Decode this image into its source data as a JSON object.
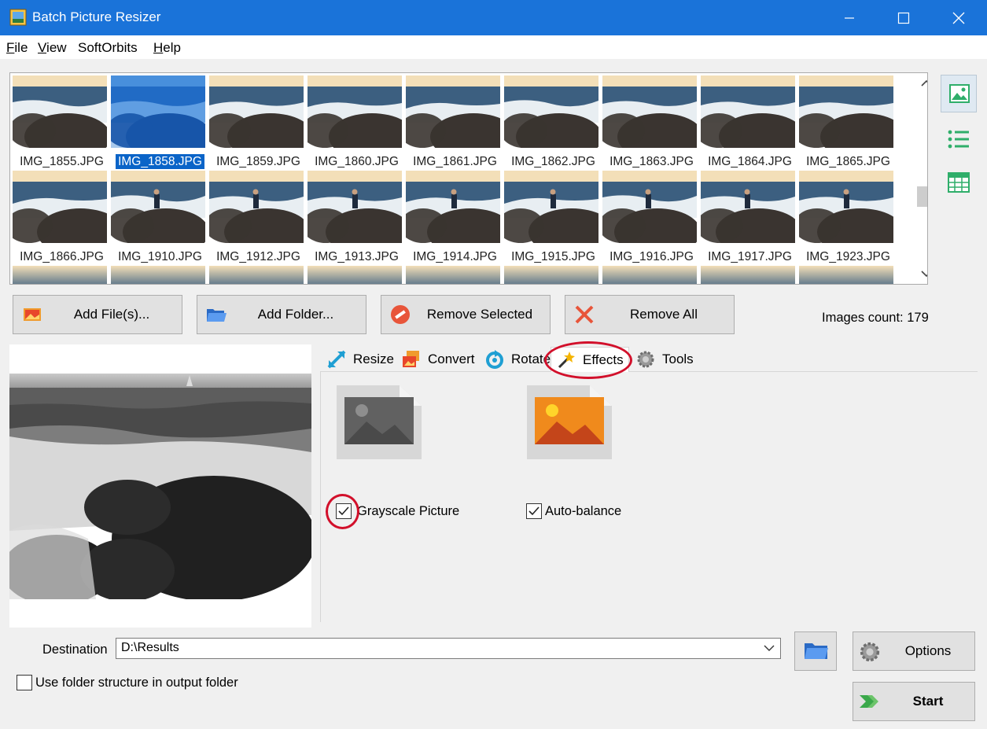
{
  "window": {
    "title": "Batch Picture Resizer"
  },
  "menu": [
    {
      "label": "File",
      "u": "F",
      "rest": "ile"
    },
    {
      "label": "View",
      "u": "V",
      "rest": "iew"
    },
    {
      "label": "SoftOrbits",
      "u": "",
      "rest": "SoftOrbits"
    },
    {
      "label": "Help",
      "u": "H",
      "rest": "elp"
    }
  ],
  "thumbnails": [
    [
      "IMG_1855.JPG",
      "IMG_1858.JPG",
      "IMG_1859.JPG",
      "IMG_1860.JPG",
      "IMG_1861.JPG",
      "IMG_1862.JPG",
      "IMG_1863.JPG",
      "IMG_1864.JPG",
      "IMG_1865.JPG"
    ],
    [
      "IMG_1866.JPG",
      "IMG_1910.JPG",
      "IMG_1912.JPG",
      "IMG_1913.JPG",
      "IMG_1914.JPG",
      "IMG_1915.JPG",
      "IMG_1916.JPG",
      "IMG_1917.JPG",
      "IMG_1923.JPG"
    ]
  ],
  "selected_thumbnail": "IMG_1858.JPG",
  "actions": {
    "add_files": "Add File(s)...",
    "add_folder": "Add Folder...",
    "remove_selected": "Remove Selected",
    "remove_all": "Remove All"
  },
  "images_count": "Images count: 179",
  "tabs": {
    "resize": "Resize",
    "convert": "Convert",
    "rotate": "Rotate",
    "effects": "Effects",
    "tools": "Tools"
  },
  "active_tab": "Effects",
  "effects": {
    "grayscale_label": "Grayscale Picture",
    "grayscale_checked": true,
    "autobalance_label": "Auto-balance",
    "autobalance_checked": true
  },
  "destination": {
    "label": "Destination",
    "value": "D:\\Results"
  },
  "folder_structure": {
    "label": "Use folder structure in output folder",
    "checked": false
  },
  "buttons": {
    "options": "Options",
    "start": "Start"
  },
  "colors": {
    "titlebar": "#1a73d9",
    "selection": "#0a64c8",
    "highlight_ring": "#d2102b"
  }
}
